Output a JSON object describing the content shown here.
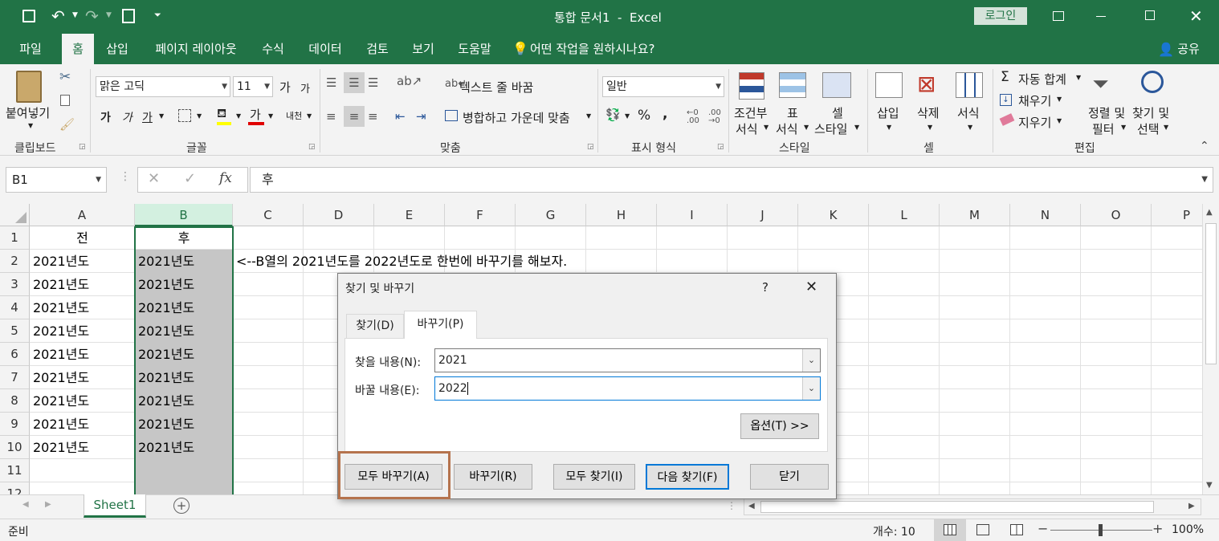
{
  "titlebar": {
    "title": "통합 문서1  -  Excel",
    "login": "로그인"
  },
  "tabs": [
    "파일",
    "홈",
    "삽입",
    "페이지 레이아웃",
    "수식",
    "데이터",
    "검토",
    "보기",
    "도움말"
  ],
  "tellme": "어떤 작업을 원하시나요?",
  "share": "공유",
  "ribbon": {
    "clipboard": {
      "paste": "붙여넣기",
      "label": "클립보드"
    },
    "font": {
      "name": "맑은 고딕",
      "size": "11",
      "grow": "가",
      "shrink": "가",
      "bold": "가",
      "italic": "가",
      "underline": "가",
      "fontcolor": "가",
      "label": "글꼴",
      "phonetic": "내천"
    },
    "align": {
      "wrap": "텍스트 줄 바꿈",
      "merge": "병합하고 가운데 맞춤",
      "label": "맞춤"
    },
    "number": {
      "format": "일반",
      "percent": "%",
      "comma": ",",
      "label": "표시 형식"
    },
    "styles": {
      "cond1": "조건부",
      "cond2": "서식",
      "table1": "표",
      "table2": "서식",
      "cell1": "셀",
      "cell2": "스타일",
      "label": "스타일"
    },
    "cells": {
      "insert": "삽입",
      "delete": "삭제",
      "format": "서식",
      "label": "셀"
    },
    "editing": {
      "autosum": "자동 합계",
      "fill": "채우기",
      "clear": "지우기",
      "sort1": "정렬 및",
      "sort2": "필터",
      "find1": "찾기 및",
      "find2": "선택",
      "label": "편집"
    }
  },
  "formula": {
    "namebox": "B1",
    "content": "후",
    "fx": "fx"
  },
  "columns": [
    "A",
    "B",
    "C",
    "D",
    "E",
    "F",
    "G",
    "H",
    "I",
    "J",
    "K",
    "L",
    "M",
    "N",
    "O",
    "P"
  ],
  "rows": [
    "1",
    "2",
    "3",
    "4",
    "5",
    "6",
    "7",
    "8",
    "9",
    "10",
    "11",
    "12"
  ],
  "cells": {
    "A": [
      "전",
      "2021년도",
      "2021년도",
      "2021년도",
      "2021년도",
      "2021년도",
      "2021년도",
      "2021년도",
      "2021년도",
      "2021년도"
    ],
    "B": [
      "후",
      "2021년도",
      "2021년도",
      "2021년도",
      "2021년도",
      "2021년도",
      "2021년도",
      "2021년도",
      "2021년도",
      "2021년도"
    ],
    "C2": "<--B열의 2021년도를 2022년도로 한번에 바꾸기를 해보자."
  },
  "sheet": {
    "name": "Sheet1"
  },
  "status": {
    "ready": "준비",
    "count": "개수: 10",
    "zoom": "100%"
  },
  "dialog": {
    "title": "찾기 및 바꾸기",
    "help": "?",
    "tab_find": "찾기(D)",
    "tab_replace": "바꾸기(P)",
    "find_label": "찾을 내용(N):",
    "find_value": "2021",
    "replace_label": "바꿀 내용(E):",
    "replace_value": "2022",
    "options": "옵션(T) >>",
    "replace_all": "모두 바꾸기(A)",
    "replace": "바꾸기(R)",
    "find_all": "모두 찾기(I)",
    "find_next": "다음 찾기(F)",
    "close": "닫기"
  },
  "colors": {
    "excel_green": "#217346",
    "highlight_box": "#b5734d",
    "selection": "#c6c6c6"
  }
}
